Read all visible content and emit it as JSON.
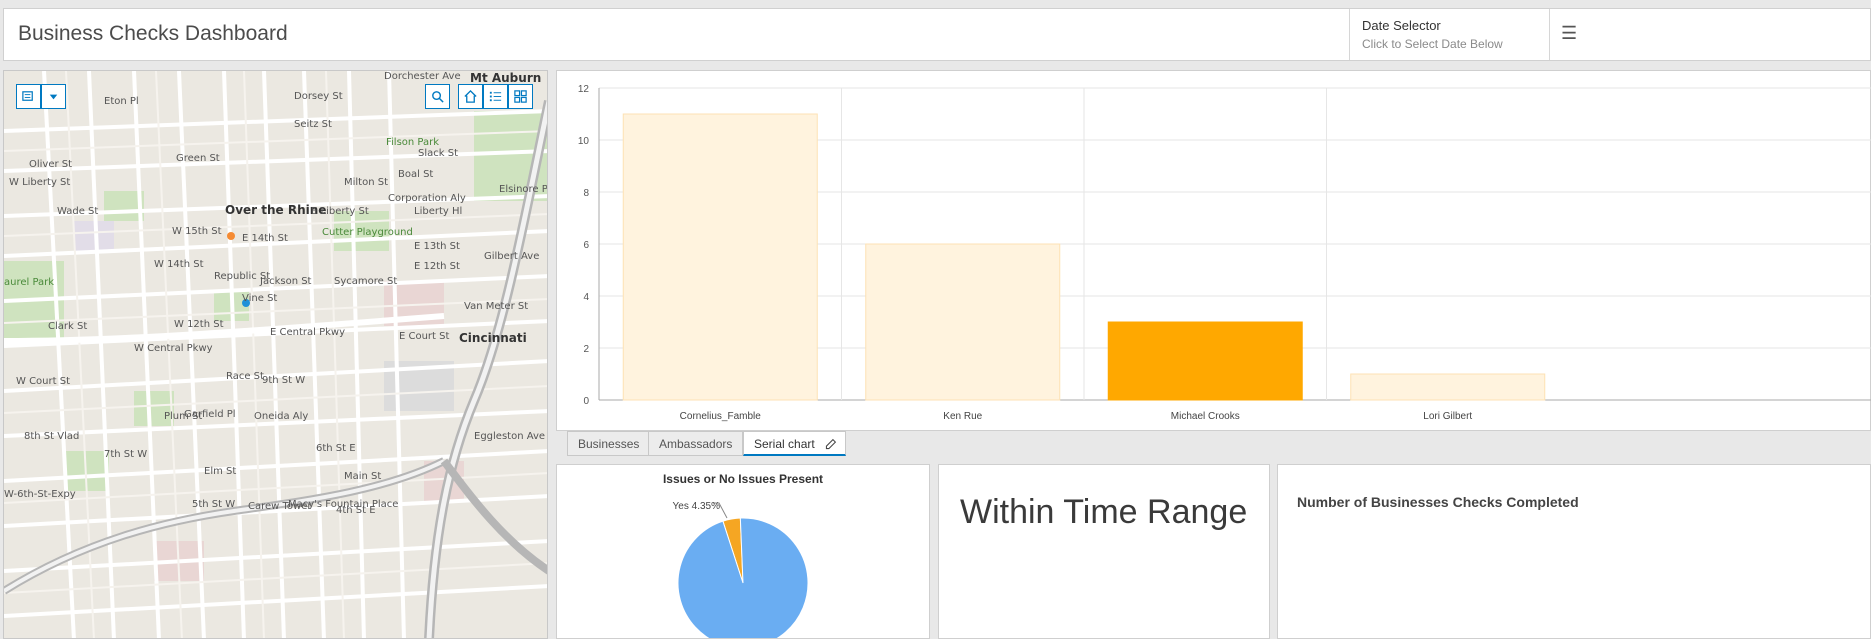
{
  "header": {
    "title": "Business Checks Dashboard",
    "date_selector_label": "Date Selector",
    "date_selector_hint": "Click to Select Date Below"
  },
  "map": {
    "labels": {
      "neighborhood": "Over the Rhine",
      "city": "Cincinnati",
      "mt_auburn": "Mt Auburn",
      "park1": "Cutter Playground",
      "park2": "Filson Park",
      "laurel": "aurel Park",
      "w15": "W 15th St",
      "e14": "E 14th St",
      "w14": "W 14th St",
      "w12": "W 12th St",
      "central": "W Central Pkwy",
      "ecentral": "E Central Pkwy",
      "liberty": "W Liberty St",
      "eliberty": "E Liberty St",
      "wade": "Wade St",
      "green": "Green St",
      "oliver": "Oliver St",
      "clark": "Clark St",
      "court": "W Court St",
      "ecourt": "E Court St",
      "ninth": "9th St W",
      "seventh": "7th St W",
      "fifth": "5th St W",
      "sixth": "6th St E",
      "fourth": "4th St E",
      "milton": "Milton St",
      "boal": "Boal St",
      "slack": "Slack St",
      "corp": "Corporation Aly",
      "libhl": "Liberty Hl",
      "e13": "E 13th St",
      "e12": "E 12th St",
      "elsinore": "Elsinore Pl",
      "gilbert": "Gilbert Ave",
      "vanmeter": "Van Meter St",
      "eggleston": "Eggleston Ave",
      "garfield": "Garfield Pl",
      "oneida": "Oneida Aly",
      "macys": "Macy's Fountain Place",
      "carew": "Carew Tower",
      "expy": "W-6th-St-Expy",
      "eighth": "8th St Vlad",
      "dorsey": "Dorsey St",
      "seitz": "Seitz St",
      "dorchester": "Dorchester Ave",
      "eton": "Eton Pl",
      "race": "Race St",
      "elm": "Elm St",
      "plum": "Plum St",
      "main": "Main St",
      "vine": "Vine St",
      "sycamore": "Sycamore St",
      "jackson": "Jackson St",
      "republic": "Republic St"
    },
    "icons": [
      "layers-icon",
      "dropdown-icon",
      "search-icon",
      "home-icon",
      "legend-icon",
      "basemap-gallery-icon"
    ]
  },
  "chart_data": {
    "type": "bar",
    "categories": [
      "Cornelius_Famble",
      "Ken Rue",
      "Michael Crooks",
      "Lori Gilbert"
    ],
    "values": [
      11,
      6,
      3,
      1
    ],
    "highlighted_index": 2,
    "ylim": [
      0,
      12
    ],
    "yticks": [
      0,
      2,
      4,
      6,
      8,
      10,
      12
    ],
    "colors": {
      "bar": "#fff3de",
      "bar_stroke": "#fde2b4",
      "highlight": "#ffa800",
      "grid": "#e6e6e6"
    },
    "grid": true
  },
  "tabs": [
    {
      "label": "Businesses"
    },
    {
      "label": "Ambassadors"
    },
    {
      "label": "Serial chart",
      "active": true
    }
  ],
  "pie": {
    "title": "Issues or No Issues Present",
    "label_yes": "Yes 4.35%",
    "slices": [
      {
        "name": "Yes",
        "percent": 4.35,
        "color": "#f5a623"
      },
      {
        "name": "No",
        "percent": 95.65,
        "color": "#6aadf2"
      }
    ]
  },
  "indicator": {
    "text": "Within Time Range"
  },
  "count_card": {
    "title": "Number of Businesses Checks Completed"
  }
}
